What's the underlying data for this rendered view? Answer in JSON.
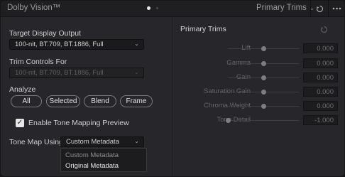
{
  "header": {
    "app_title": "Dolby Vision™",
    "mode_selector": "Primary Trims",
    "icons": [
      "reset-icon",
      "more-icon"
    ]
  },
  "left_panel": {
    "target_display_output": {
      "label": "Target Display Output",
      "value": "100-nit, BT.709, BT.1886, Full"
    },
    "trim_controls_for": {
      "label": "Trim Controls For",
      "value": "100-nit, BT.709, BT.1886, Full"
    },
    "analyze": {
      "label": "Analyze",
      "buttons": [
        "All",
        "Selected",
        "Blend",
        "Frame"
      ]
    },
    "tone_mapping_preview": {
      "label": "Enable Tone Mapping Preview",
      "checked": true
    },
    "tone_map_using": {
      "label": "Tone Map Using",
      "value": "Custom Metadata",
      "options": [
        "Custom Metadata",
        "Original Metadata"
      ]
    }
  },
  "right_panel": {
    "title": "Primary Trims",
    "trims": [
      {
        "label": "Lift",
        "value": "0.000",
        "level": 0.5
      },
      {
        "label": "Gamma",
        "value": "0.000",
        "level": 0.5
      },
      {
        "label": "Gain",
        "value": "0.000",
        "level": 0.5
      },
      {
        "label": "Saturation Gain",
        "value": "0.000",
        "level": 0.5
      },
      {
        "label": "Chroma Weight",
        "value": "0.000",
        "level": 0.5
      },
      {
        "label": "Tone Detail",
        "value": "-1.000",
        "level": 0.0
      }
    ]
  }
}
